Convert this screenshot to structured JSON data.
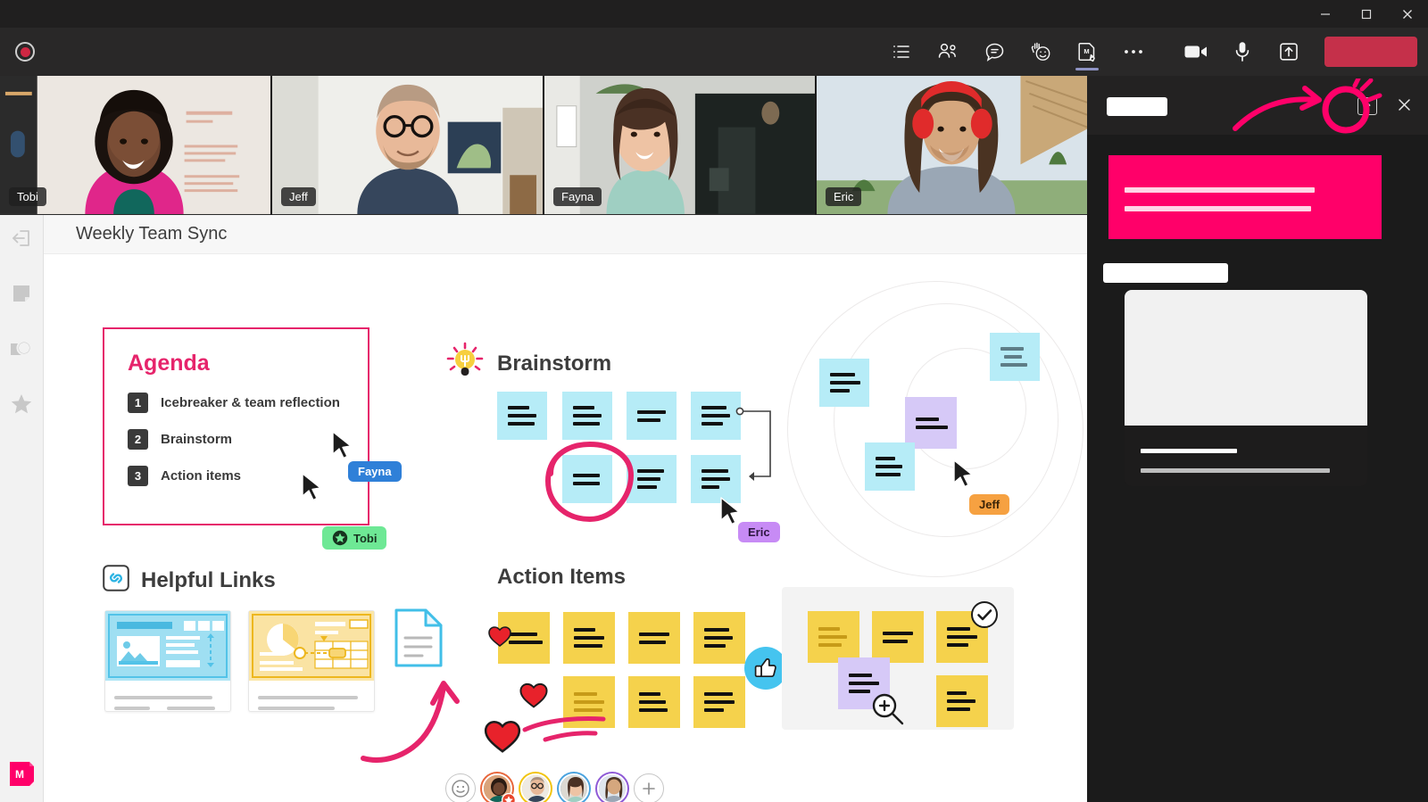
{
  "window": {
    "minimize_label": "Minimize",
    "maximize_label": "Maximize",
    "close_label": "Close"
  },
  "meeting_toolbar": {
    "recording_label": "Recording",
    "items": [
      {
        "name": "agenda-list-icon",
        "label": "Agenda"
      },
      {
        "name": "people-icon",
        "label": "People"
      },
      {
        "name": "chat-icon",
        "label": "Chat"
      },
      {
        "name": "reactions-icon",
        "label": "React"
      },
      {
        "name": "miro-board-icon",
        "label": "Miro",
        "active": true
      },
      {
        "name": "more-options-icon",
        "label": "More"
      },
      {
        "name": "camera-icon",
        "label": "Camera"
      },
      {
        "name": "microphone-icon",
        "label": "Mic"
      },
      {
        "name": "share-screen-icon",
        "label": "Share"
      }
    ],
    "leave_label": ""
  },
  "participants": [
    {
      "name": "Tobi",
      "ring": "#e8663b"
    },
    {
      "name": "Jeff",
      "ring": "#f1c40f"
    },
    {
      "name": "Fayna",
      "ring": "#4aa3df"
    },
    {
      "name": "Eric",
      "ring": "#8e59d6"
    }
  ],
  "miro": {
    "board_title": "Weekly Team Sync",
    "rail": [
      {
        "name": "collapse-panel-icon",
        "label": "Collapse"
      },
      {
        "name": "sticky-note-icon",
        "label": "Sticky note"
      },
      {
        "name": "shapes-icon",
        "label": "Shapes"
      },
      {
        "name": "star-icon",
        "label": "Favorites"
      }
    ],
    "logo_letter": "M",
    "agenda": {
      "title": "Agenda",
      "items": [
        {
          "num": "1",
          "text": "Icebreaker & team reflection"
        },
        {
          "num": "2",
          "text": "Brainstorm"
        },
        {
          "num": "3",
          "text": "Action items"
        }
      ]
    },
    "sections": [
      {
        "key": "brainstorm",
        "title": "Brainstorm",
        "icon": "lightbulb-icon"
      },
      {
        "key": "helpful_links",
        "title": "Helpful Links",
        "icon": "link-icon"
      },
      {
        "key": "action_items",
        "title": "Action Items",
        "icon": ""
      }
    ],
    "cursors": [
      {
        "name": "Fayna",
        "bg": "#2f80d8",
        "fg": "#ffffff",
        "star": false
      },
      {
        "name": "Tobi",
        "bg": "#6ee895",
        "fg": "#17321f",
        "star": true
      },
      {
        "name": "Eric",
        "bg": "#c78bf5",
        "fg": "#2c1640",
        "star": false
      },
      {
        "name": "Jeff",
        "bg": "#f6a141",
        "fg": "#3a2408",
        "star": false
      }
    ],
    "reactions": {
      "thumbs_up": "👍",
      "hearts": 3,
      "check_badge": "✓",
      "zoom_badge": "+"
    },
    "avatar_bar": {
      "emoji_button": "☺",
      "add_button": "+"
    }
  },
  "right_panel": {
    "share_icon": "pop-out-icon",
    "close_icon": "close-icon",
    "redacted": true
  },
  "colors": {
    "miro_pink": "#e6246b",
    "banner_pink": "#ff0069",
    "sticky_blue": "#b6ecf7",
    "sticky_yellow": "#f5d24c",
    "sticky_purple": "#d6c9f7",
    "leave_red": "#c5304a",
    "annotation_pink": "#ff0069"
  }
}
